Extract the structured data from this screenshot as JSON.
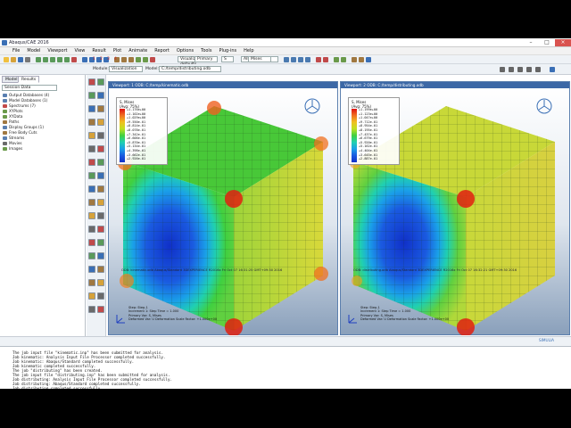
{
  "window": {
    "title": "Abaqus/CAE 2016"
  },
  "menu": [
    "File",
    "Model",
    "Viewport",
    "View",
    "Result",
    "Plot",
    "Animate",
    "Report",
    "Options",
    "Tools",
    "Plug-ins",
    "Help"
  ],
  "toolbar": {
    "view_combo": "Visualization defaults",
    "all_combo": "All",
    "frame_nums": [
      "1",
      "2",
      "3",
      "4"
    ],
    "primary": "Primary",
    "S": "S",
    "mises": "Mises",
    "module_label": "Module:",
    "module_value": "Visualization",
    "model_label": "Model:",
    "model_value": "C:/temp/distributing.odb"
  },
  "sidebar": {
    "tabs": [
      "Model",
      "Results"
    ],
    "session_label": "Session Data",
    "items": [
      {
        "label": "Output Databases (4)",
        "color": "#5a7fb0"
      },
      {
        "label": "Model Databases (1)",
        "color": "#5a7fb0"
      },
      {
        "label": "Spectrums (7)",
        "color": "#c24a4a"
      },
      {
        "label": "XYPlots",
        "color": "#6a9a4a"
      },
      {
        "label": "XYData",
        "color": "#6a9a4a"
      },
      {
        "label": "Paths",
        "color": "#a07840"
      },
      {
        "label": "Display Groups (1)",
        "color": "#5a7fb0"
      },
      {
        "label": "Free Body Cuts",
        "color": "#a07840"
      },
      {
        "label": "Streams",
        "color": "#5a7fb0"
      },
      {
        "label": "Movies",
        "color": "#6a6a6a"
      },
      {
        "label": "Images",
        "color": "#6a9a4a"
      }
    ]
  },
  "viewports": [
    {
      "title": "Viewport: 1    ODB: C:/temp/kinematic.odb",
      "legend_head": [
        "S, Mises",
        "(Avg: 75%)"
      ],
      "legend_vals": [
        "+1.176e+00",
        "+1.102e+00",
        "+1.029e+00",
        "+9.550e-01",
        "+8.814e-01",
        "+8.078e-01",
        "+7.342e-01",
        "+6.606e-01",
        "+5.870e-01",
        "+5.134e-01",
        "+4.398e-01",
        "+3.662e-01",
        "+2.926e-01"
      ],
      "odb_line": "ODB: kinematic.odb    Abaqus/Standard 3DEXPERIENCE R2016x    Fri Oct 07 16:31:25 GMT+09:30 2016",
      "step_info": [
        "Step: Step-1",
        "Increment    1: Step Time =    1.000",
        "Primary Var: S, Mises",
        "Deformed Var: U   Deformation Scale Factor: +1.000e+00"
      ]
    },
    {
      "title": "Viewport: 2    ODB: C:/temp/distributing.odb",
      "legend_head": [
        "S, Mises",
        "(Avg: 75%)"
      ],
      "legend_vals": [
        "+1.199e+00",
        "+1.123e+00",
        "+1.047e+00",
        "+9.712e-01",
        "+8.954e-01",
        "+8.195e-01",
        "+7.437e-01",
        "+6.679e-01",
        "+5.920e-01",
        "+5.162e-01",
        "+4.404e-01",
        "+3.645e-01",
        "+2.887e-01"
      ],
      "odb_line": "ODB: distributing.odb    Abaqus/Standard 3DEXPERIENCE R2016x    Fri Oct 07 16:32:21 GMT+09:30 2016",
      "step_info": [
        "Step: Step-1",
        "Increment    1: Step Time =    1.000",
        "Primary Var: S, Mises",
        "Deformed Var: U   Deformation Scale Factor: +1.000e+00"
      ]
    }
  ],
  "messages": [
    "The job input file \"kinematic.inp\" has been submitted for analysis.",
    "Job kinematic: Analysis Input File Processor completed successfully.",
    "Job kinematic: Abaqus/Standard completed successfully.",
    "Job kinematic completed successfully.",
    "The job \"distributing\" has been created.",
    "The job input file \"distributing.inp\" has been submitted for analysis.",
    "Job distributing: Analysis Input File Processor completed successfully.",
    "Job distributing: Abaqus/Standard completed successfully.",
    "Job distributing completed successfully."
  ],
  "brand": "SIMULIA"
}
